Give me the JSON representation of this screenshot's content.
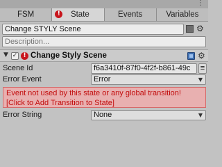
{
  "tabs": [
    {
      "label": "FSM",
      "active": false,
      "error": false
    },
    {
      "label": "State",
      "active": true,
      "error": true
    },
    {
      "label": "Events",
      "active": false,
      "error": false
    },
    {
      "label": "Variables",
      "active": false,
      "error": false
    }
  ],
  "state": {
    "name": "Change STYLY Scene",
    "description_placeholder": "Description..."
  },
  "action": {
    "title": "Change Styly Scene",
    "enabled": true
  },
  "properties": {
    "scene_id_label": "Scene Id",
    "scene_id_value": "f6a3410f-87f0-4f2f-b861-49c",
    "error_event_label": "Error Event",
    "error_event_value": "Error",
    "error_string_label": "Error String",
    "error_string_value": "None"
  },
  "error_message": {
    "line1": "Event not used by this state or any global transition!",
    "line2": "[Click to Add Transition to State]"
  },
  "icons": {
    "error": "error-icon",
    "gear": "gear-icon",
    "book": "book-icon",
    "menu": "kebab-menu-icon"
  },
  "colors": {
    "error_red": "#c8161d",
    "error_bg": "#e8b0b0",
    "error_text": "#c20d0d"
  }
}
